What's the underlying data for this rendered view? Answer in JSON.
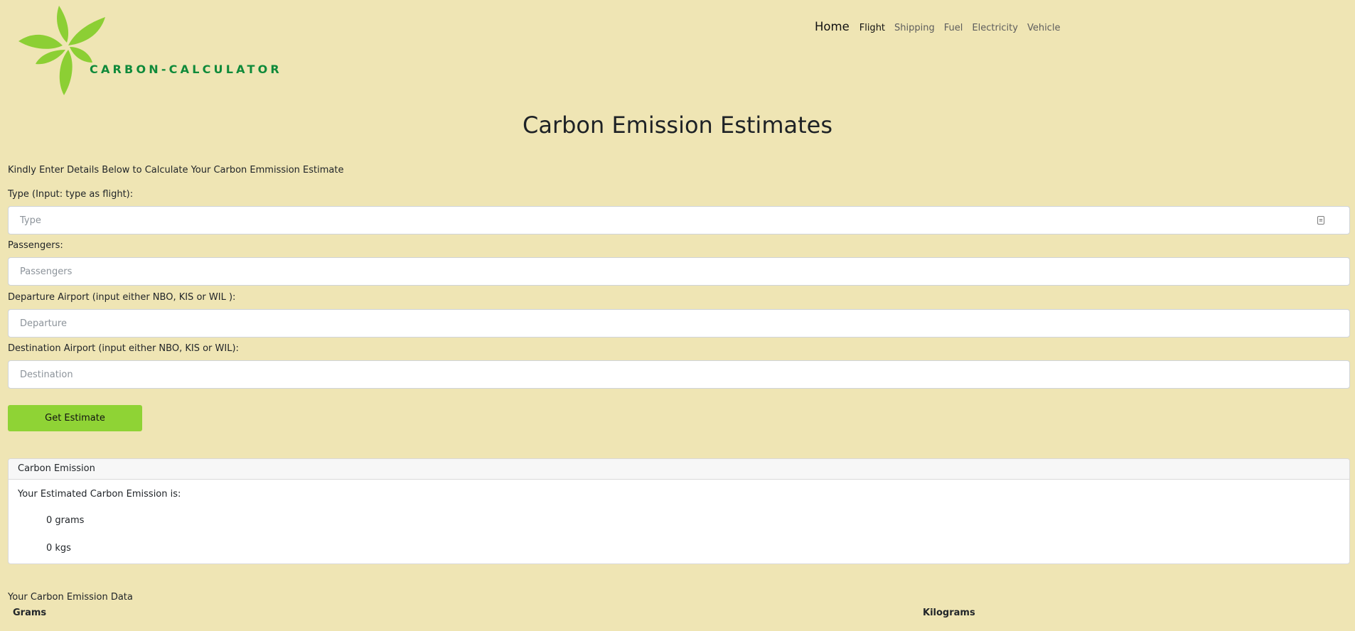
{
  "header": {
    "logo_text": "CARBON-CALCULATOR",
    "nav": {
      "home": "Home",
      "items": [
        "Flight",
        "Shipping",
        "Fuel",
        "Electricity",
        "Vehicle"
      ]
    }
  },
  "page_title": "Carbon Emission Estimates",
  "form": {
    "intro": "Kindly Enter Details Below to Calculate Your Carbon Emmission Estimate",
    "type_label": "Type (Input: type as flight):",
    "type_placeholder": "Type",
    "passengers_label": "Passengers:",
    "passengers_placeholder": "Passengers",
    "departure_label": "Departure Airport (input either NBO, KIS or WIL ):",
    "departure_placeholder": "Departure",
    "destination_label": "Destination Airport (input either NBO, KIS or WIL):",
    "destination_placeholder": "Destination",
    "submit_label": "Get Estimate"
  },
  "result": {
    "header": "Carbon Emission",
    "intro": "Your Estimated Carbon Emission is:",
    "grams": "0 grams",
    "kgs": "0 kgs"
  },
  "data_table": {
    "title": "Your Carbon Emission Data",
    "columns": [
      "Grams",
      "Kilograms"
    ]
  },
  "colors": {
    "background": "#efe5b4",
    "accent_button": "#8fd335",
    "logo_leaf": "#8ccf34",
    "logo_text": "#0f8a3a"
  }
}
